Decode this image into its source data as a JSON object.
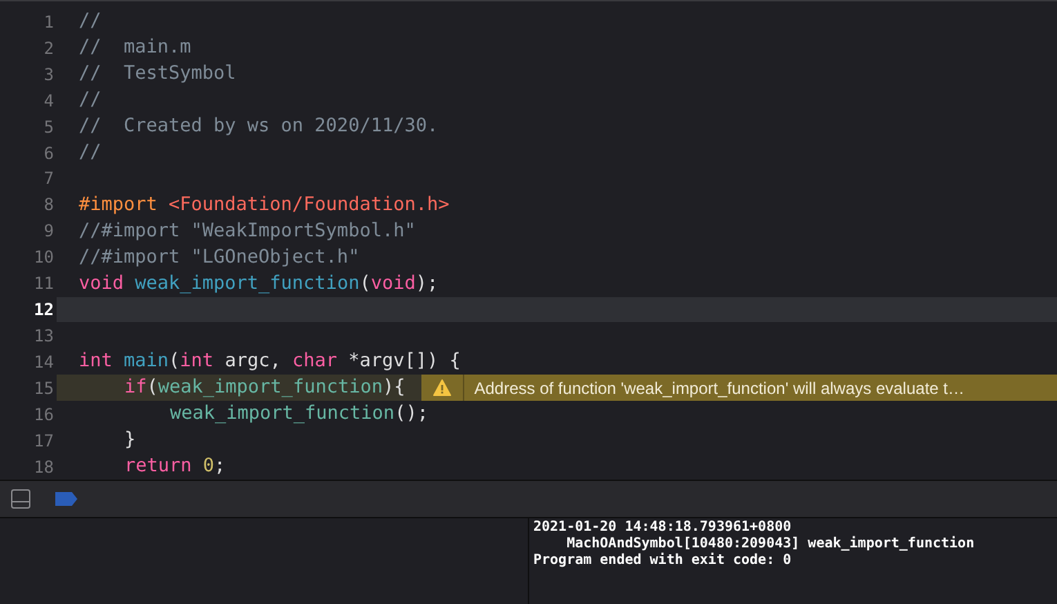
{
  "editor": {
    "lines": [
      {
        "number": "1",
        "current": false,
        "tokens": [
          {
            "kind": "comment",
            "text": "//"
          }
        ]
      },
      {
        "number": "2",
        "current": false,
        "tokens": [
          {
            "kind": "comment",
            "text": "//  main.m"
          }
        ]
      },
      {
        "number": "3",
        "current": false,
        "tokens": [
          {
            "kind": "comment",
            "text": "//  TestSymbol"
          }
        ]
      },
      {
        "number": "4",
        "current": false,
        "tokens": [
          {
            "kind": "comment",
            "text": "//"
          }
        ]
      },
      {
        "number": "5",
        "current": false,
        "tokens": [
          {
            "kind": "comment",
            "text": "//  Created by ws on 2020/11/30."
          }
        ]
      },
      {
        "number": "6",
        "current": false,
        "tokens": [
          {
            "kind": "comment",
            "text": "//"
          }
        ]
      },
      {
        "number": "7",
        "current": false
      },
      {
        "number": "8",
        "current": false,
        "tokens": [
          {
            "kind": "preprocessor",
            "text": "#import "
          },
          {
            "kind": "header",
            "text": "<Foundation/Foundation.h>"
          }
        ]
      },
      {
        "number": "9",
        "current": false,
        "tokens": [
          {
            "kind": "comment",
            "text": "//#import \"WeakImportSymbol.h\""
          }
        ]
      },
      {
        "number": "10",
        "current": false,
        "tokens": [
          {
            "kind": "comment",
            "text": "//#import \"LGOneObject.h\""
          }
        ]
      },
      {
        "number": "11",
        "current": false,
        "tokens": [
          {
            "kind": "keyword",
            "text": "void "
          },
          {
            "kind": "declaration",
            "text": "weak_import_function"
          },
          {
            "kind": "plain",
            "text": "("
          },
          {
            "kind": "keyword",
            "text": "void"
          },
          {
            "kind": "plain",
            "text": ");"
          }
        ]
      },
      {
        "number": "12",
        "current": true
      },
      {
        "number": "13",
        "current": false
      },
      {
        "number": "14",
        "current": false,
        "tokens": [
          {
            "kind": "keyword",
            "text": "int "
          },
          {
            "kind": "declaration",
            "text": "main"
          },
          {
            "kind": "plain",
            "text": "("
          },
          {
            "kind": "keyword",
            "text": "int"
          },
          {
            "kind": "plain",
            "text": " argc, "
          },
          {
            "kind": "keyword",
            "text": "char"
          },
          {
            "kind": "plain",
            "text": " *argv[]) {"
          }
        ],
        "children": [
          {
            "number": "15",
            "current": false,
            "warning": {
              "message": "Address of function 'weak_import_function' will always evaluate t…"
            },
            "tokens": [
              {
                "kind": "keyword",
                "text": "if"
              },
              {
                "kind": "plain",
                "text": "("
              },
              {
                "kind": "call",
                "text": "weak_import_function"
              },
              {
                "kind": "plain",
                "text": "){"
              }
            ],
            "children": [
              {
                "number": "16",
                "current": false,
                "tokens": [
                  {
                    "kind": "call",
                    "text": "weak_import_function"
                  },
                  {
                    "kind": "plain",
                    "text": "();"
                  }
                ]
              }
            ]
          },
          {
            "number": "17",
            "current": false,
            "tokens": [
              {
                "kind": "plain",
                "text": "}"
              }
            ]
          },
          {
            "number": "18",
            "current": false,
            "tokens": [
              {
                "kind": "keyword",
                "text": "return "
              },
              {
                "kind": "number",
                "text": "0"
              },
              {
                "kind": "plain",
                "text": ";"
              }
            ]
          }
        ]
      }
    ]
  },
  "debug_bar": {
    "breakpoints_active": true
  },
  "console": {
    "lines": [
      "2021-01-20 14:48:18.793961+0800",
      "    MachOAndSymbol[10480:209043] weak_import_function",
      "Program ended with exit code: 0"
    ]
  }
}
